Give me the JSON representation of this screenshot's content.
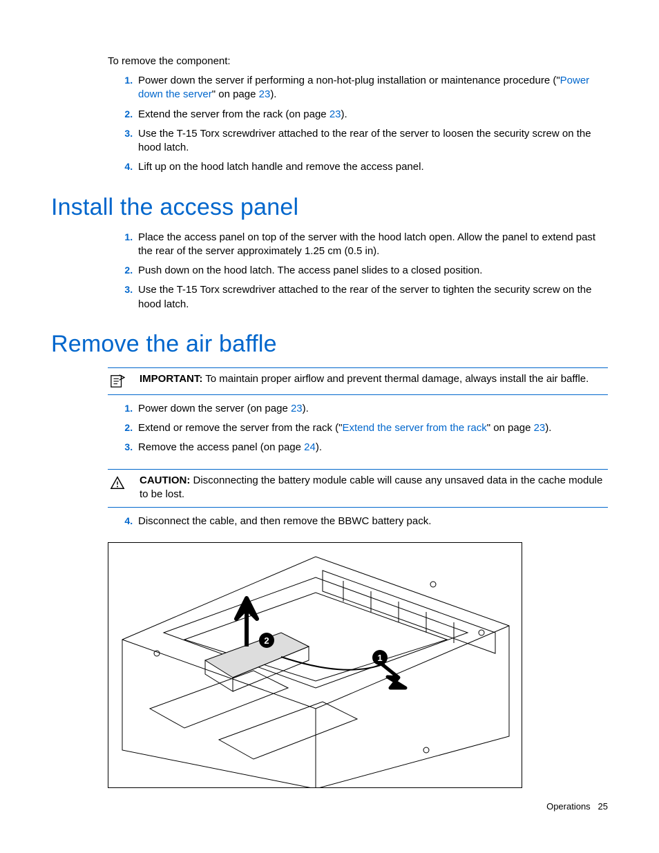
{
  "intro": "To remove the component:",
  "remove_steps": [
    {
      "pre": "Power down the server if performing a non-hot-plug installation or maintenance procedure (\"",
      "link": "Power down the server",
      "mid": "\" on page ",
      "page": "23",
      "post": ")."
    },
    {
      "pre": "Extend the server from the rack (on page ",
      "page": "23",
      "post": ")."
    },
    {
      "text": "Use the T-15 Torx screwdriver attached to the rear of the server to loosen the security screw on the hood latch."
    },
    {
      "text": "Lift up on the hood latch handle and remove the access panel."
    }
  ],
  "heading_install": "Install the access panel",
  "install_steps": [
    {
      "text": "Place the access panel on top of the server with the hood latch open. Allow the panel to extend past the rear of the server approximately 1.25 cm (0.5 in)."
    },
    {
      "text": "Push down on the hood latch. The access panel slides to a closed position."
    },
    {
      "text": "Use the T-15 Torx screwdriver attached to the rear of the server to tighten the security screw on the hood latch."
    }
  ],
  "heading_baffle": "Remove the air baffle",
  "important_label": "IMPORTANT:",
  "important_text": "  To maintain proper airflow and prevent thermal damage, always install the air baffle.",
  "baffle_steps_a": [
    {
      "pre": "Power down the server (on page ",
      "page": "23",
      "post": ")."
    },
    {
      "pre": "Extend or remove the server from the rack (\"",
      "link": "Extend the server from the rack",
      "mid": "\" on page ",
      "page": "23",
      "post": ")."
    },
    {
      "pre": "Remove the access panel (on page ",
      "page": "24",
      "post": ")."
    }
  ],
  "caution_label": "CAUTION:",
  "caution_text": "  Disconnecting the battery module cable will cause any unsaved data in the cache module to be lost.",
  "baffle_step4": "Disconnect the cable, and then remove the BBWC battery pack.",
  "figure": {
    "badge1": "1",
    "badge2": "2"
  },
  "footer_section": "Operations",
  "footer_page": "25"
}
